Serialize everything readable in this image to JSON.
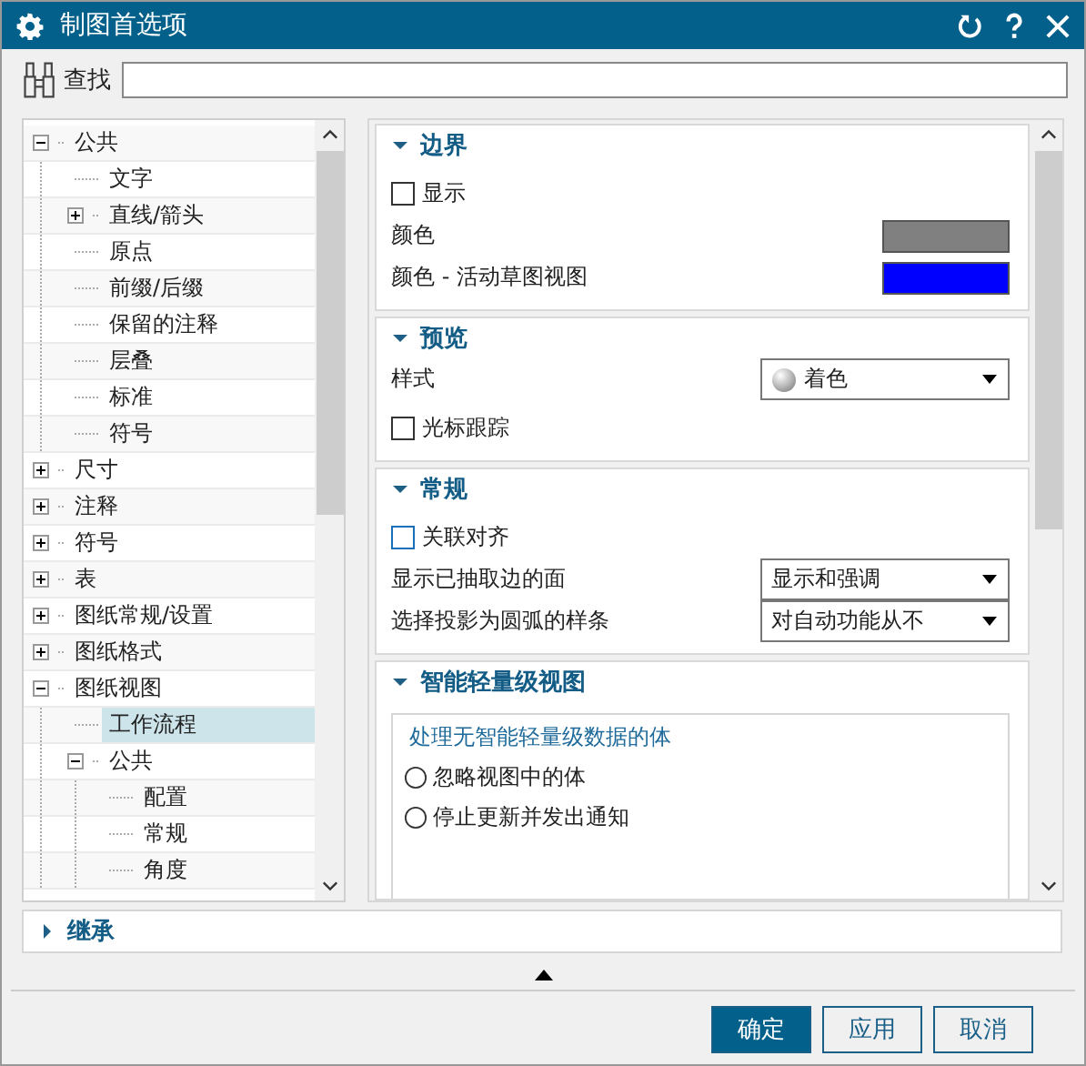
{
  "window": {
    "title": "制图首选项"
  },
  "search": {
    "label": "查找"
  },
  "tree": [
    {
      "label": "公共",
      "expanded": true,
      "selected": false,
      "children": [
        {
          "label": "文字",
          "selected": false
        },
        {
          "label": "直线/箭头",
          "expanded": false,
          "selected": false
        },
        {
          "label": "原点",
          "selected": false
        },
        {
          "label": "前缀/后缀",
          "selected": false
        },
        {
          "label": "保留的注释",
          "selected": false
        },
        {
          "label": "层叠",
          "selected": false
        },
        {
          "label": "标准",
          "selected": false
        },
        {
          "label": "符号",
          "selected": false
        }
      ]
    },
    {
      "label": "尺寸",
      "expanded": false,
      "selected": false
    },
    {
      "label": "注释",
      "expanded": false,
      "selected": false
    },
    {
      "label": "符号",
      "expanded": false,
      "selected": false
    },
    {
      "label": "表",
      "expanded": false,
      "selected": false
    },
    {
      "label": "图纸常规/设置",
      "expanded": false,
      "selected": false
    },
    {
      "label": "图纸格式",
      "expanded": false,
      "selected": false
    },
    {
      "label": "图纸视图",
      "expanded": true,
      "selected": false,
      "children": [
        {
          "label": "工作流程",
          "selected": true
        },
        {
          "label": "公共",
          "expanded": true,
          "selected": false,
          "children": [
            {
              "label": "配置",
              "selected": false
            },
            {
              "label": "常规",
              "selected": false
            },
            {
              "label": "角度",
              "selected": false
            }
          ]
        }
      ]
    }
  ],
  "sections": [
    {
      "title": "边界",
      "expanded": true,
      "rows": [
        {
          "kind": "checkbox",
          "label": "显示",
          "checked": false,
          "focused": false
        },
        {
          "kind": "color",
          "label": "颜色",
          "color": "#808080"
        },
        {
          "kind": "color",
          "label": "颜色 - 活动草图视图",
          "color": "#0000ff"
        }
      ]
    },
    {
      "title": "预览",
      "expanded": true,
      "rows": [
        {
          "kind": "shaded-dropdown",
          "label": "样式",
          "value": "着色"
        },
        {
          "kind": "checkbox",
          "label": "光标跟踪",
          "checked": false,
          "focused": false
        }
      ]
    },
    {
      "title": "常规",
      "expanded": true,
      "rows": [
        {
          "kind": "checkbox",
          "label": "关联对齐",
          "checked": false,
          "focused": true
        },
        {
          "kind": "dropdown",
          "label": "显示已抽取边的面",
          "value": "显示和强调"
        },
        {
          "kind": "dropdown",
          "label": "选择投影为圆弧的样条",
          "value": "对自动功能从不"
        }
      ]
    },
    {
      "title": "智能轻量级视图",
      "expanded": true,
      "rows": [
        {
          "kind": "radio-group",
          "label": "处理无智能轻量级数据的体",
          "options": [
            {
              "label": "忽略视图中的体",
              "selected": false
            },
            {
              "label": "停止更新并发出通知",
              "selected": false
            }
          ]
        }
      ]
    }
  ],
  "footer_section": {
    "title": "继承",
    "expanded": false
  },
  "buttons": [
    {
      "label": "确定",
      "kind": "primary"
    },
    {
      "label": "应用",
      "kind": "normal"
    },
    {
      "label": "取消",
      "kind": "normal"
    }
  ]
}
